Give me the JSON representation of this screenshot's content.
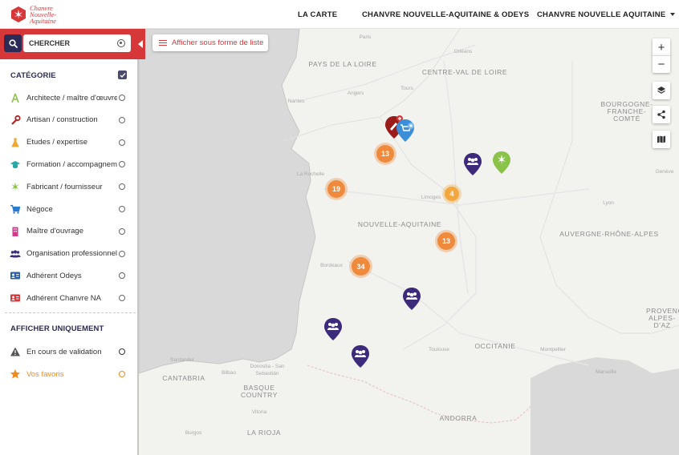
{
  "header": {
    "logo_text_line1": "Chanvre",
    "logo_text_line2": "Nouvelle-",
    "logo_text_line3": "Aquitaine",
    "nav": [
      "LA CARTE",
      "CHANVRE NOUVELLE-AQUITAINE & ODEYS",
      "CHANVRE NOUVELLE AQUITAINE"
    ]
  },
  "search": {
    "placeholder": "CHERCHER"
  },
  "sidebar": {
    "category_title": "CATÉGORIE",
    "categories": [
      {
        "label": "Architecte / maître d'œuvre",
        "icon": "compass-icon",
        "color": "#8bc34a"
      },
      {
        "label": "Artisan / construction",
        "icon": "wrench-icon",
        "color": "#b22222"
      },
      {
        "label": "Etudes / expertise",
        "icon": "flask-icon",
        "color": "#f0a830"
      },
      {
        "label": "Formation / accompagnement",
        "icon": "graduation-cap-icon",
        "color": "#2aa7a7"
      },
      {
        "label": "Fabricant / fournisseur",
        "icon": "hemp-leaf-icon",
        "color": "#8bc34a"
      },
      {
        "label": "Négoce",
        "icon": "cart-icon",
        "color": "#2b7bd0"
      },
      {
        "label": "Maître d'ouvrage",
        "icon": "building-icon",
        "color": "#d43a8c"
      },
      {
        "label": "Organisation professionnelle",
        "icon": "users-icon",
        "color": "#3d2a7a"
      },
      {
        "label": "Adhérent Odeys",
        "icon": "id-card-icon",
        "color": "#2b5fa8"
      },
      {
        "label": "Adhérent Chanvre NA",
        "icon": "id-card-icon",
        "color": "#d6383a"
      }
    ],
    "filter_title": "AFFICHER UNIQUEMENT",
    "filters": [
      {
        "label": "En cours de validation",
        "icon": "warning-icon",
        "color": "#555555"
      },
      {
        "label": "Vos favoris",
        "icon": "star-icon",
        "color": "#f08a1c"
      }
    ]
  },
  "map": {
    "list_button": "Afficher sous forme de liste",
    "zoom_in": "+",
    "zoom_out": "−",
    "clusters": [
      "13",
      "19",
      "4",
      "13",
      "34"
    ],
    "regions": [
      "PAYS DE LA LOIRE",
      "CENTRE-VAL DE LOIRE",
      "BOURGOGNE-FRANCHE-COMTÉ",
      "NOUVELLE-AQUITAINE",
      "AUVERGNE-RHÔNE-ALPES",
      "OCCITANIE",
      "PROVENCE-ALPES-D'AZ",
      "CANTABRIA",
      "BASQUE COUNTRY",
      "LA RIOJA",
      "ANDORRA"
    ],
    "cities": [
      "Paris",
      "Orléans",
      "Tours",
      "Angers",
      "Nantes",
      "La Rochelle",
      "Limoges",
      "Bordeaux",
      "Toulouse",
      "Montpellier",
      "Marseille",
      "Lyon",
      "Genève",
      "Santander",
      "Bilbao",
      "Donostia - San Sebastián",
      "Burgos",
      "Vitoria"
    ]
  },
  "colors": {
    "brand_red": "#d6383a",
    "navy": "#2b2b55",
    "cluster_orange": "#ef8a3c",
    "pin_purple": "#3d2a7a"
  }
}
